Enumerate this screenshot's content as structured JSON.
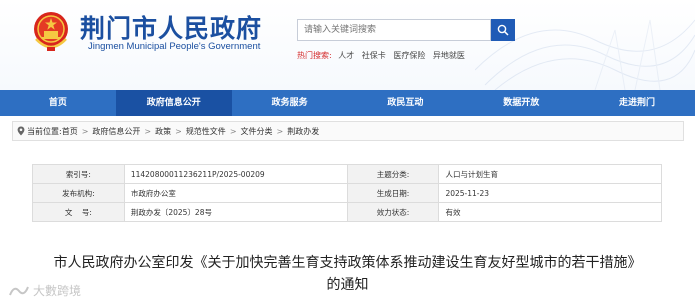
{
  "header": {
    "title": "荆门市人民政府",
    "subtitle": "Jingmen Municipal People's Government",
    "search_placeholder": "请输入关键词搜索",
    "hot_label": "热门搜索:",
    "hot_items": [
      "人才",
      "社保卡",
      "医疗保险",
      "异地就医"
    ]
  },
  "nav": [
    "首页",
    "政府信息公开",
    "政务服务",
    "政民互动",
    "数据开放",
    "走进荆门"
  ],
  "nav_active_index": 1,
  "breadcrumb": {
    "location_label": "当前位置:",
    "items": [
      "首页",
      "政府信息公开",
      "政策",
      "规范性文件",
      "文件分类",
      "荆政办发"
    ]
  },
  "info": {
    "index_label": "索引号:",
    "index_value": "114208000112362​11P/2025-00209",
    "topic_label": "主题分类:",
    "topic_value": "人口与计划生育",
    "publisher_label": "发布机构:",
    "publisher_value": "市政府办公室",
    "date_label": "生成日期:",
    "date_value": "2025-11-23",
    "docno_label": "文    号:",
    "docno_value": "荆政办发〔2025〕28号",
    "status_label": "效力状态:",
    "status_value": "有效"
  },
  "document": {
    "title_line1": "市人民政府办公室印发《关于加快完善生育支持政策体系推动建设生育友好型城市的若干措施》",
    "title_line2": "的通知"
  },
  "watermark": "大數跨境",
  "colors": {
    "brand": "#1b4fa0",
    "nav": "#2e6fc2",
    "nav_active": "#1a51a3",
    "hot": "#d42b2b"
  }
}
